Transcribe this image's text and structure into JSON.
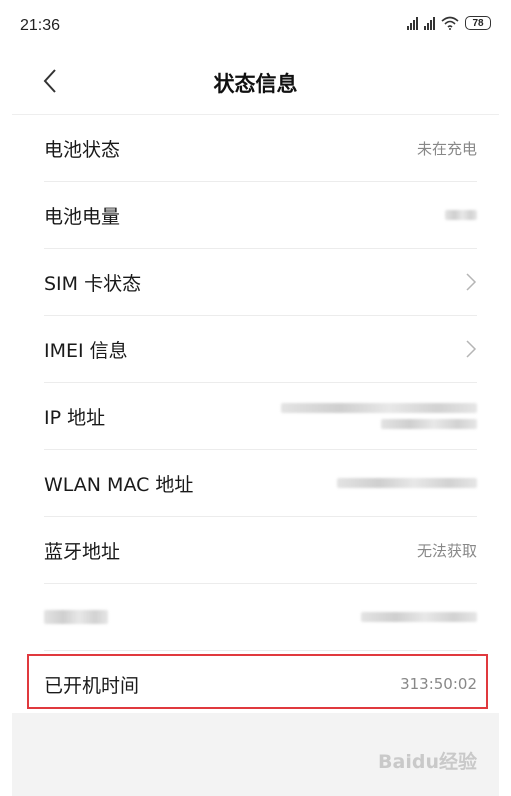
{
  "status_bar": {
    "time": "21:36",
    "battery_level": "78",
    "icons": [
      "signal-icon",
      "signal-icon",
      "wifi-icon",
      "battery-icon"
    ]
  },
  "header": {
    "title": "状态信息",
    "back_icon": "chevron-left-icon"
  },
  "rows": [
    {
      "label": "电池状态",
      "value": "未在充电"
    },
    {
      "label": "电池电量",
      "value": ""
    },
    {
      "label": "SIM 卡状态",
      "value": ""
    },
    {
      "label": "IMEI 信息",
      "value": ""
    },
    {
      "label": "IP 地址",
      "value": ""
    },
    {
      "label": "WLAN MAC 地址",
      "value": ""
    },
    {
      "label": "蓝牙地址",
      "value": "无法获取"
    },
    {
      "label": "",
      "value": ""
    },
    {
      "label": "已开机时间",
      "value": "313:50:02"
    }
  ],
  "watermark": "Baidu经验",
  "colors": {
    "highlight": "#e0393e",
    "value_text": "#888888",
    "background": "#ffffff"
  }
}
